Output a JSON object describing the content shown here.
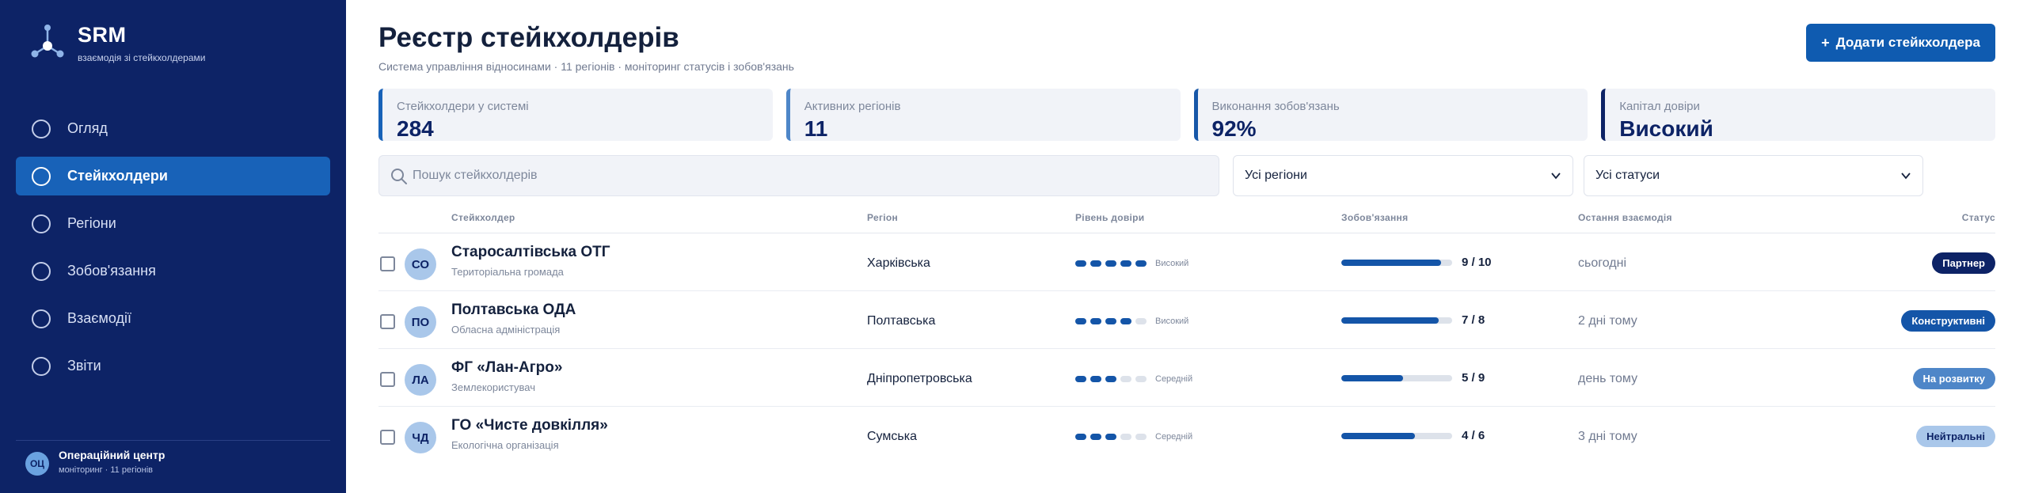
{
  "brand": {
    "name": "SRM",
    "subtitle": "взаємодія зі стейкхолдерами"
  },
  "nav": [
    {
      "label": "Огляд",
      "active": false
    },
    {
      "label": "Стейкхолдери",
      "active": true
    },
    {
      "label": "Регіони",
      "active": false
    },
    {
      "label": "Зобов'язання",
      "active": false
    },
    {
      "label": "Взаємодії",
      "active": false
    },
    {
      "label": "Звіти",
      "active": false
    }
  ],
  "operator": {
    "initials": "ОЦ",
    "name": "Операційний центр",
    "sub": "моніторинг · 11 регіонів"
  },
  "header": {
    "title": "Реєстр стейкхолдерів",
    "subtitle": "Система управління відносинами · 11 регіонів · моніторинг статусів і зобов'язань",
    "add_button": "Додати стейкхолдера",
    "add_button_icon": "+"
  },
  "stats": [
    {
      "label": "Стейкхолдери у системі",
      "value": "284"
    },
    {
      "label": "Активних регіонів",
      "value": "11"
    },
    {
      "label": "Виконання зобов'язань",
      "value": "92%"
    },
    {
      "label": "Капітал довіри",
      "value": "Високий"
    }
  ],
  "filters": {
    "search_placeholder": "Пошук стейкхолдерів",
    "regions_value": "Усі регіони",
    "statuses_value": "Усі статуси"
  },
  "table": {
    "columns": [
      "Стейкхолдер",
      "Регіон",
      "Рівень довіри",
      "Зобов'язання",
      "Остання взаємодія",
      "Статус"
    ],
    "rows": [
      {
        "initials": "СО",
        "name": "Старосалтівська ОТГ",
        "type": "Територіальна громада",
        "region": "Харківська",
        "trust_level": 5,
        "trust_label": "Високий",
        "commit_done": 9,
        "commit_total": 10,
        "commit_text": "9 / 10",
        "last": "сьогодні",
        "status": "Партнер",
        "status_kind": "partner"
      },
      {
        "initials": "ПО",
        "name": "Полтавська ОДА",
        "type": "Обласна адміністрація",
        "region": "Полтавська",
        "trust_level": 4,
        "trust_label": "Високий",
        "commit_done": 7,
        "commit_total": 8,
        "commit_text": "7 / 8",
        "last": "2 дні тому",
        "status": "Конструктивні",
        "status_kind": "constr"
      },
      {
        "initials": "ЛА",
        "name": "ФГ «Лан-Агро»",
        "type": "Землекористувач",
        "region": "Дніпропетровська",
        "trust_level": 3,
        "trust_label": "Середній",
        "commit_done": 5,
        "commit_total": 9,
        "commit_text": "5 / 9",
        "last": "день тому",
        "status": "На розвитку",
        "status_kind": "develop"
      },
      {
        "initials": "ЧД",
        "name": "ГО «Чисте довкілля»",
        "type": "Екологічна організація",
        "region": "Сумська",
        "trust_level": 3,
        "trust_label": "Середній",
        "commit_done": 4,
        "commit_total": 6,
        "commit_text": "4 / 6",
        "last": "3 дні тому",
        "status": "Нейтральні",
        "status_kind": "neutral"
      }
    ]
  },
  "colors": {
    "sidebar": "#0d2366",
    "accent": "#1862b8",
    "primary": "#0f5bb0"
  }
}
